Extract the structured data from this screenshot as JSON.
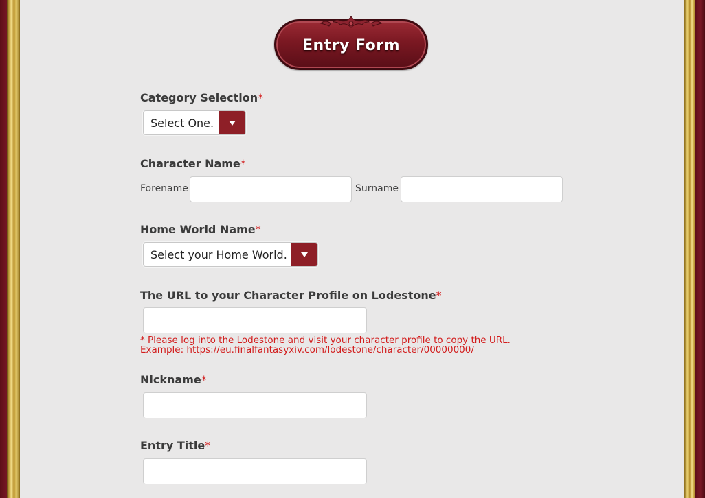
{
  "form": {
    "title": "Entry Form",
    "required_mark": "*",
    "category": {
      "label": "Category Selection",
      "selected": "Select One."
    },
    "character_name": {
      "label": "Character Name",
      "forename_label": "Forename",
      "forename_value": "",
      "surname_label": "Surname",
      "surname_value": ""
    },
    "home_world": {
      "label": "Home World Name",
      "selected": "Select your Home World."
    },
    "lodestone_url": {
      "label": "The URL to your Character Profile on Lodestone",
      "value": "",
      "note_line1": "* Please log into the Lodestone and visit your character profile to copy the URL.",
      "note_line2": "Example: https://eu.finalfantasyxiv.com/lodestone/character/00000000/"
    },
    "nickname": {
      "label": "Nickname",
      "value": ""
    },
    "entry_title": {
      "label": "Entry Title",
      "value": ""
    }
  },
  "icons": {
    "dropdown": "chevron-down-icon",
    "ornament": "ornament-icon"
  },
  "colors": {
    "frame_red": "#6e1420",
    "gold": "#c9a440",
    "panel_bg": "#e9e8e8",
    "badge_red": "#7a1822",
    "dropdown_red": "#8e1f27",
    "required_red": "#d21d1d"
  }
}
